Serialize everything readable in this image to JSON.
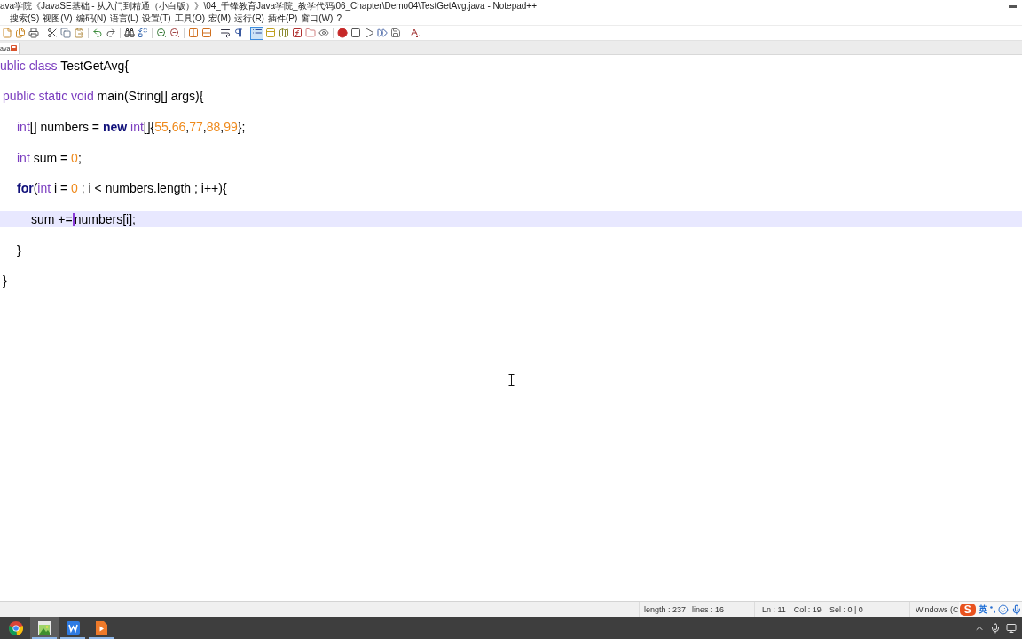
{
  "window": {
    "title": "ava学院《JavaSE基础 - 从入门到精通（小白版）》\\04_千锋教育Java学院_教学代码\\06_Chapter\\Demo04\\TestGetAvg.java - Notepad++"
  },
  "menu": [
    "搜索(S)",
    "视图(V)",
    "编码(N)",
    "语言(L)",
    "设置(T)",
    "工具(O)",
    "宏(M)",
    "运行(R)",
    "插件(P)",
    "窗口(W)",
    "?"
  ],
  "toolbar": {
    "groups": [
      [
        {
          "kind": "close",
          "pressed": false
        },
        {
          "kind": "close-all",
          "pressed": false
        },
        {
          "kind": "print",
          "pressed": false
        }
      ],
      [
        {
          "kind": "cut",
          "pressed": false
        },
        {
          "kind": "copy",
          "pressed": false
        },
        {
          "kind": "paste",
          "pressed": false
        }
      ],
      [
        {
          "kind": "undo",
          "pressed": false
        },
        {
          "kind": "redo",
          "pressed": false
        }
      ],
      [
        {
          "kind": "find",
          "pressed": false
        },
        {
          "kind": "replace",
          "pressed": false
        }
      ],
      [
        {
          "kind": "zoom-in",
          "pressed": false
        },
        {
          "kind": "zoom-out",
          "pressed": false
        }
      ],
      [
        {
          "kind": "sync-vertical",
          "pressed": false
        },
        {
          "kind": "sync-horizontal",
          "pressed": false
        }
      ],
      [
        {
          "kind": "word-wrap",
          "pressed": false
        },
        {
          "kind": "show-all-chars",
          "pressed": false
        }
      ],
      [
        {
          "kind": "indent-guide",
          "pressed": true
        },
        {
          "kind": "language",
          "pressed": false
        },
        {
          "kind": "document-map",
          "pressed": false
        },
        {
          "kind": "function-list",
          "pressed": false
        },
        {
          "kind": "folder-workspace",
          "pressed": false
        },
        {
          "kind": "monitoring",
          "pressed": false
        }
      ],
      [
        {
          "kind": "record",
          "pressed": false
        },
        {
          "kind": "stop",
          "pressed": false
        },
        {
          "kind": "play",
          "pressed": false
        },
        {
          "kind": "run-multiple",
          "pressed": false
        },
        {
          "kind": "save-macro",
          "pressed": false
        }
      ],
      [
        {
          "kind": "spellcheck",
          "pressed": false
        }
      ]
    ]
  },
  "tabs": [
    {
      "label": "ava",
      "selected": true
    }
  ],
  "editor": {
    "lines": [
      {
        "current": false,
        "tokens": [
          {
            "kind": "keyword",
            "text": "ublic class"
          },
          {
            "kind": "plain",
            "text": " TestGetAvg{"
          }
        ],
        "children": [
          {
            "current": false,
            "tokens": [
              {
                "kind": "keyword",
                "text": "public static void"
              },
              {
                "kind": "plain",
                "text": " main(String[] args){"
              }
            ],
            "children": [
              {
                "current": false,
                "tokens": [
                  {
                    "kind": "keyword",
                    "text": "int"
                  },
                  {
                    "kind": "plain",
                    "text": "[] numbers = "
                  },
                  {
                    "kind": "bold",
                    "text": "new "
                  },
                  {
                    "kind": "keyword",
                    "text": "int"
                  },
                  {
                    "kind": "plain",
                    "text": "[]{"
                  },
                  {
                    "kind": "number",
                    "text": "55"
                  },
                  {
                    "kind": "plain",
                    "text": ","
                  },
                  {
                    "kind": "number",
                    "text": "66"
                  },
                  {
                    "kind": "plain",
                    "text": ","
                  },
                  {
                    "kind": "number",
                    "text": "77"
                  },
                  {
                    "kind": "plain",
                    "text": ","
                  },
                  {
                    "kind": "number",
                    "text": "88"
                  },
                  {
                    "kind": "plain",
                    "text": ","
                  },
                  {
                    "kind": "number",
                    "text": "99"
                  },
                  {
                    "kind": "plain",
                    "text": "};"
                  }
                ]
              },
              {
                "current": false,
                "tokens": [
                  {
                    "kind": "keyword",
                    "text": "int"
                  },
                  {
                    "kind": "plain",
                    "text": " sum = "
                  },
                  {
                    "kind": "number",
                    "text": "0"
                  },
                  {
                    "kind": "plain",
                    "text": ";"
                  }
                ]
              },
              {
                "current": false,
                "tokens": [
                  {
                    "kind": "bold",
                    "text": "for"
                  },
                  {
                    "kind": "plain",
                    "text": "("
                  },
                  {
                    "kind": "keyword",
                    "text": "int"
                  },
                  {
                    "kind": "plain",
                    "text": " i = "
                  },
                  {
                    "kind": "number",
                    "text": "0"
                  },
                  {
                    "kind": "plain",
                    "text": " ; i < numbers.length ; i++){"
                  }
                ],
                "children": [
                  {
                    "current": true,
                    "tokens": [
                      {
                        "kind": "plain",
                        "text": "sum +="
                      },
                      {
                        "kind": "caret"
                      },
                      {
                        "kind": "plain",
                        "text": "numbers[i];"
                      }
                    ]
                  }
                ]
              },
              {
                "current": false,
                "tokens": [
                  {
                    "kind": "plain",
                    "text": "}"
                  }
                ]
              }
            ]
          },
          {
            "current": false,
            "tokens": [
              {
                "kind": "plain",
                "text": "}"
              }
            ]
          }
        ]
      }
    ]
  },
  "status_bar": {
    "sections": [
      [
        "length : 237",
        "lines : 16"
      ],
      [
        "Ln : 11",
        "Col : 19",
        "Sel : 0 | 0"
      ],
      [
        "Windows (C"
      ]
    ]
  },
  "ime": {
    "logo": "S",
    "mode": "英"
  },
  "taskbar": {
    "items": [
      {
        "kind": "browser",
        "running": false,
        "selected": false
      },
      {
        "kind": "picture",
        "running": true,
        "selected": true
      },
      {
        "kind": "document",
        "running": true,
        "selected": false
      },
      {
        "kind": "player",
        "running": true,
        "selected": false
      }
    ]
  }
}
